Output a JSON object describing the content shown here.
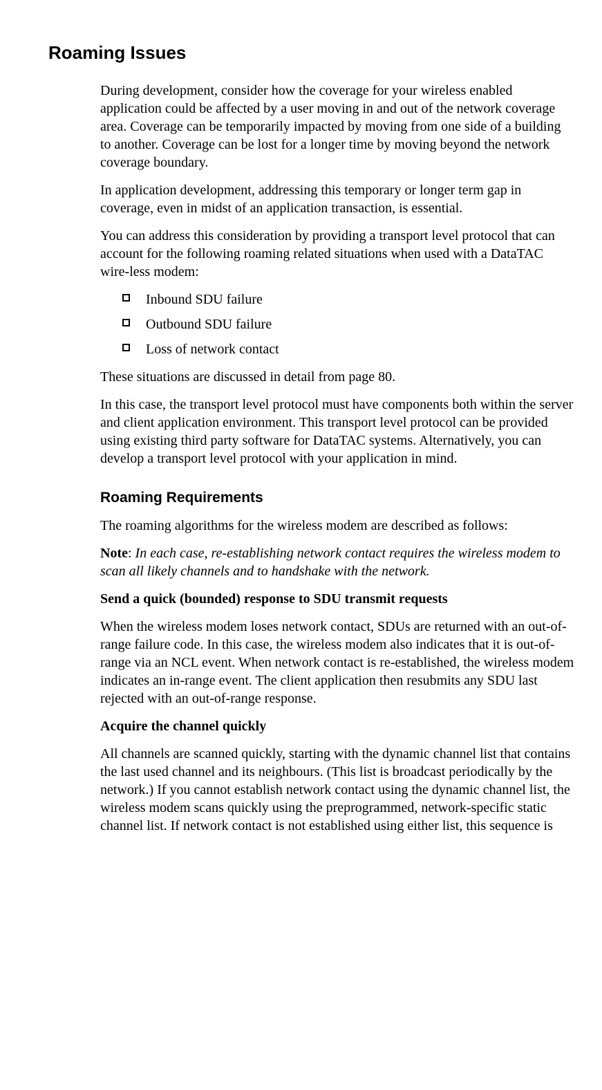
{
  "title": "Roaming Issues",
  "para1": "During development, consider how the coverage for your wireless enabled application could be affected by a user moving in and out of the network coverage area. Coverage can be temporarily impacted by moving from one side of a building to another. Coverage can be lost for a longer time by moving beyond the network coverage boundary.",
  "para2": "In application development, addressing this temporary or longer term gap in coverage, even in midst of an application transaction, is essential.",
  "para3": "You can address this consideration by providing a transport level protocol that can account for the following roaming related situations when used with a DataTAC wire-less modem:",
  "bullets": {
    "b1": "Inbound SDU failure",
    "b2": "Outbound SDU failure",
    "b3": "Loss of network contact"
  },
  "para4": "These situations are discussed in detail from page 80.",
  "para5": "In this case, the transport level protocol must have components both within the server and client application environment. This transport level protocol can be provided using existing third party software for DataTAC systems. Alternatively, you can develop a transport level protocol with your application in mind.",
  "section2_title": "Roaming Requirements",
  "s2_para1": "The roaming algorithms for the wireless modem are described as follows:",
  "note_label": "Note",
  "note_text": "In each case, re-establishing network contact requires the wireless modem to scan all likely channels and to handshake with the network.",
  "sub1_title": "Send a quick (bounded) response to SDU transmit requests",
  "sub1_para": "When the wireless modem loses network contact, SDUs are returned with an out-of-range failure code. In this case, the wireless modem also indicates that it is out-of-range via an NCL event. When network contact is re-established, the wireless modem indicates an in-range event. The client application then resubmits any SDU last rejected with an out-of-range response.",
  "sub2_title": "Acquire the channel quickly",
  "sub2_para": "All channels are scanned quickly, starting with the dynamic channel list that contains the last used channel and its neighbours. (This list is broadcast periodically by the network.) If you cannot establish network contact using the dynamic channel list, the wireless modem scans quickly using the preprogrammed, network-specific static channel list. If network contact is not established using either list, this sequence is"
}
